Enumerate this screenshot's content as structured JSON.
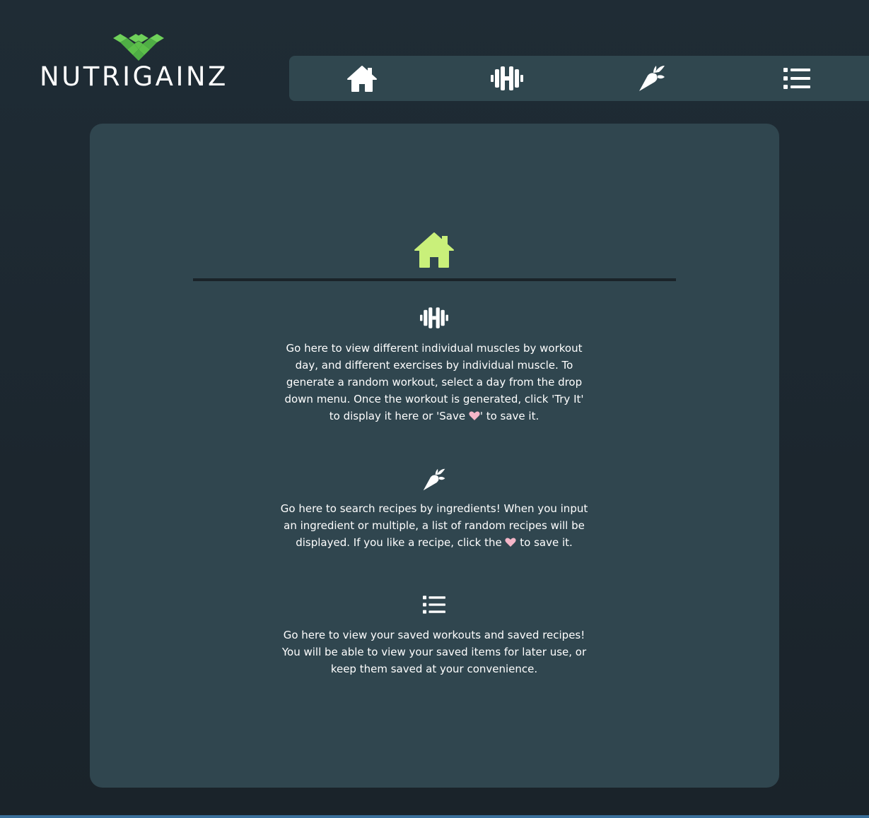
{
  "brand": {
    "name": "NUTRIGAINZ",
    "accent_color": "#5cbf4a",
    "mark_colors": [
      "#6fd15a",
      "#4fae45"
    ]
  },
  "nav": {
    "items": [
      {
        "id": "home",
        "icon": "home-icon"
      },
      {
        "id": "workouts",
        "icon": "dumbbell-icon"
      },
      {
        "id": "recipes",
        "icon": "carrot-icon"
      },
      {
        "id": "saved",
        "icon": "list-icon"
      }
    ]
  },
  "main": {
    "hero_icon": "home-icon",
    "hero_color": "#c9f07a",
    "workouts": {
      "icon": "dumbbell-icon",
      "text_before_heart": "Go here to view different individual muscles by workout day, and different exercises by individual muscle. To generate a random workout, select a day from the drop down menu. Once the workout is generated, click 'Try It' to display it here or 'Save ",
      "text_after_heart": "' to save it."
    },
    "recipes": {
      "icon": "carrot-icon",
      "text_before_heart": "Go here to search recipes by ingredients! When you input an ingredient or multiple, a list of random recipes will be displayed. If you like a recipe, click the ",
      "text_after_heart": " to save it."
    },
    "saved": {
      "icon": "list-icon",
      "text": "Go here to view your saved workouts and saved recipes! You will be able to view your saved items for later use, or keep them saved at your convenience."
    },
    "heart_icon": "heart-icon",
    "heart_color": "#f4b6c8"
  }
}
